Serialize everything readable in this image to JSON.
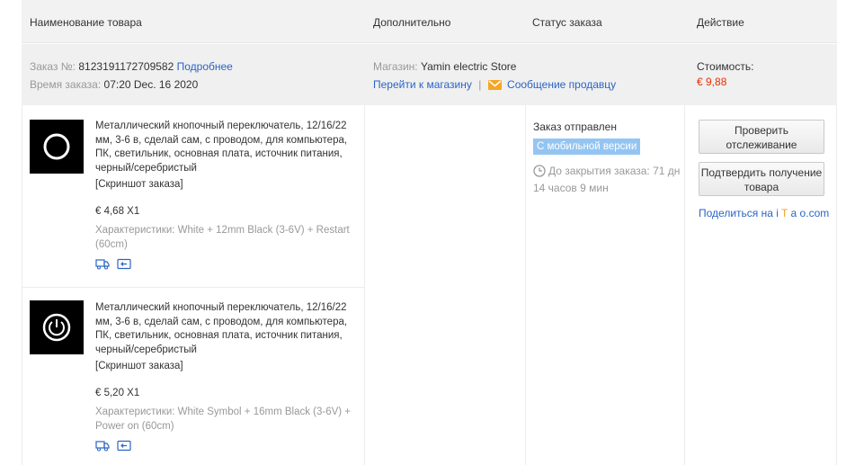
{
  "header": {
    "product_name": "Наименование товара",
    "additional": "Дополнительно",
    "order_status": "Статус заказа",
    "action": "Действие"
  },
  "order": {
    "number_label": "Заказ №:",
    "number": "8123191172709582",
    "details_link": "Подробнее",
    "time_label": "Время заказа:",
    "time": "07:20 Dec. 16 2020",
    "store_label": "Магазин:",
    "store_name": "Yamin electric Store",
    "go_to_store": "Перейти к магазину",
    "separator": "|",
    "message_seller": "Сообщение продавцу",
    "cost_label": "Стоимость:",
    "cost": "€ 9,88"
  },
  "products": [
    {
      "title": "Металлический кнопочный переключатель, 12/16/22 мм, 3-6 в, сделай сам, с проводом, для компьютера, ПК, светильник, основная плата, источник питания, черный/серебристый",
      "snapshot": "[Скриншот заказа]",
      "price": "€ 4,68 X1",
      "attributes": "Характеристики: White + 12mm Black (3-6V) + Restart (60cm)",
      "icon": "ring-icon"
    },
    {
      "title": "Металлический кнопочный переключатель, 12/16/22 мм, 3-6 в, сделай сам, с проводом, для компьютера, ПК, светильник, основная плата, источник питания, черный/серебристый",
      "snapshot": "[Скриншот заказа]",
      "price": "€ 5,20 X1",
      "attributes": "Характеристики: White Symbol + 16mm Black (3-6V) + Power on (60cm)",
      "icon": "power-icon"
    }
  ],
  "status": {
    "text": "Заказ отправлен",
    "mobile_badge": "С мобильной версии",
    "close_time": "До закрытия заказа: 71 дн 14 часов 9 мин"
  },
  "actions": {
    "track_button": "Проверить отслеживание",
    "confirm_button": "Подтвердить получение товара",
    "share_prefix": "Поделиться на",
    "share_site": [
      "i",
      "T",
      "a",
      "o",
      ".com"
    ]
  },
  "colors": {
    "link": "#2a64c5",
    "price": "#e62e04",
    "badge": "#94c5f2",
    "header_bg": "#f2f2f2"
  }
}
